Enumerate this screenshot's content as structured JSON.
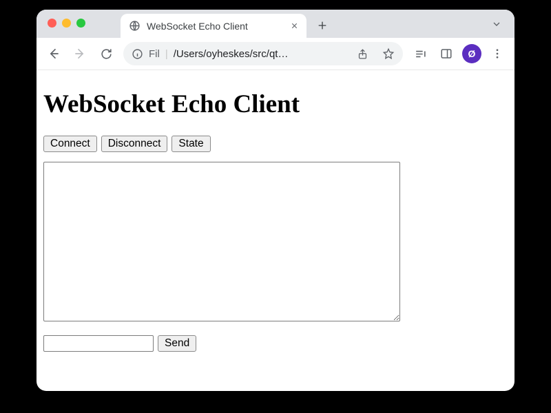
{
  "browser": {
    "tab_title": "WebSocket Echo Client",
    "omnibox_scheme_label": "Fil",
    "omnibox_path": "/Users/oyheskes/src/qt…",
    "avatar_initial": "Ø"
  },
  "page": {
    "heading": "WebSocket Echo Client",
    "buttons": {
      "connect": "Connect",
      "disconnect": "Disconnect",
      "state": "State",
      "send": "Send"
    },
    "log_value": "",
    "message_value": ""
  }
}
